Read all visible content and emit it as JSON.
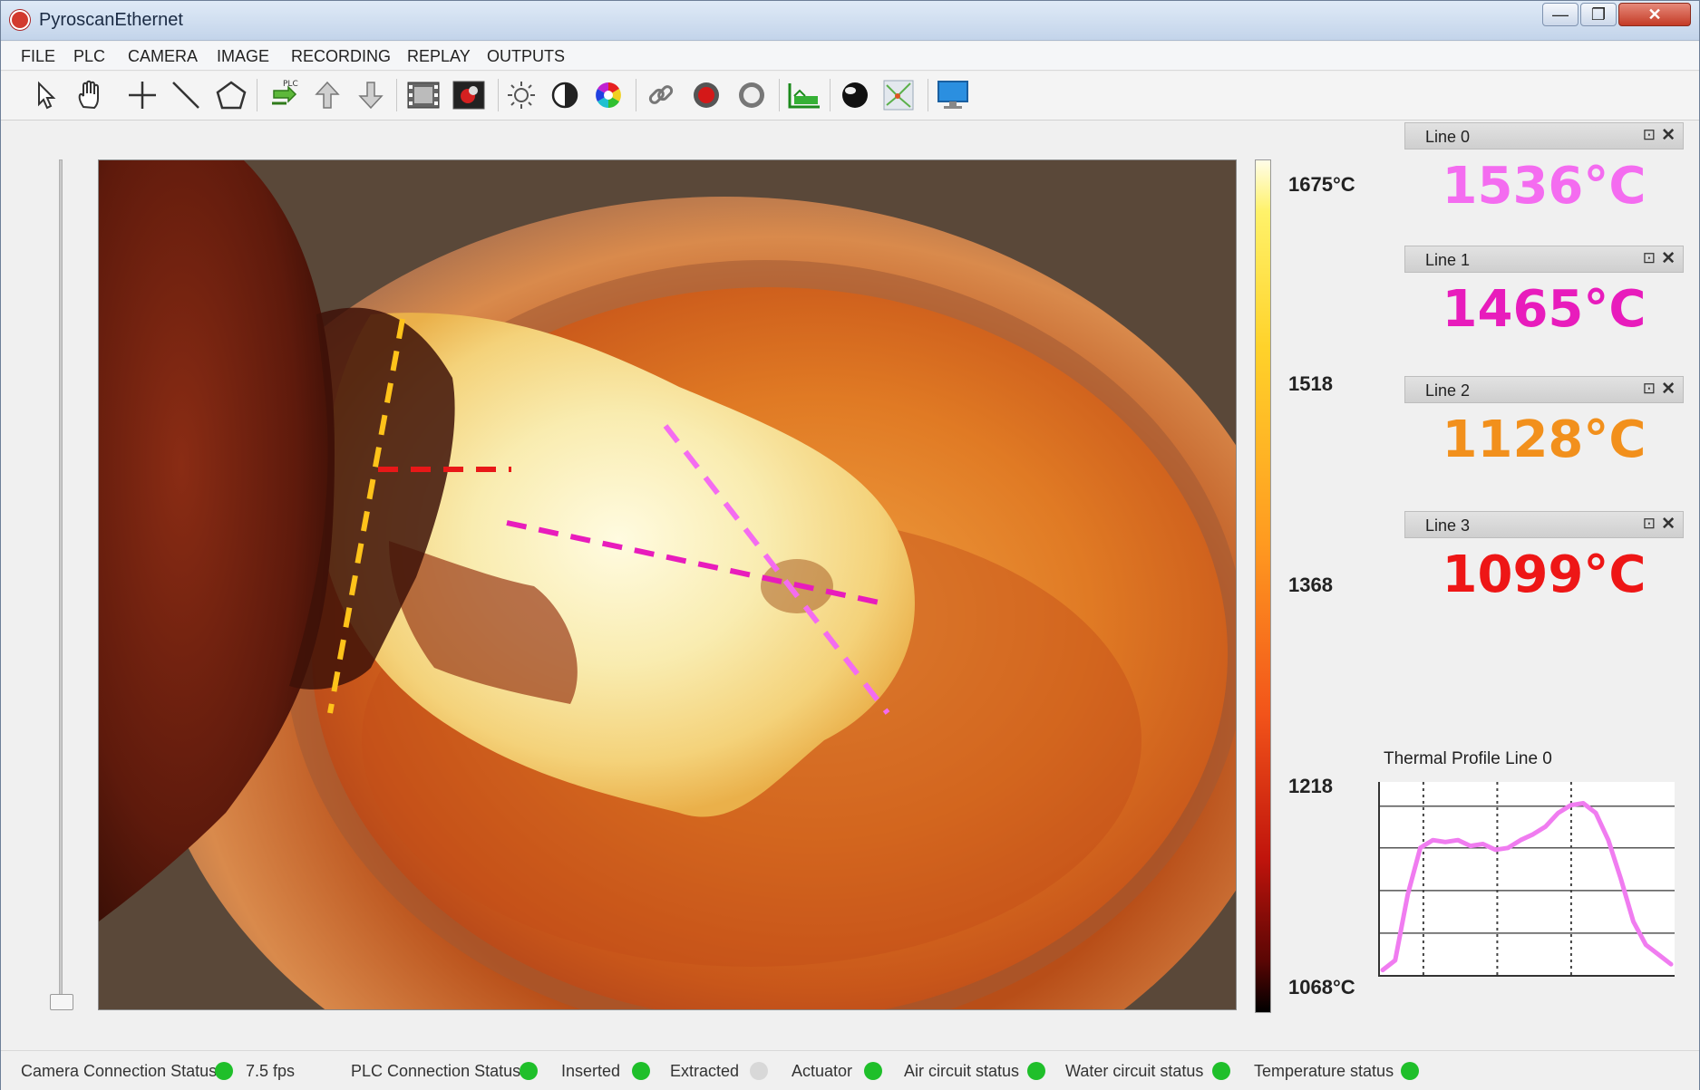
{
  "window": {
    "title": "PyroscanEthernet",
    "min_glyph": "—",
    "max_glyph": "❐",
    "close_glyph": "✕"
  },
  "menu": [
    "FILE",
    "PLC",
    "CAMERA",
    "IMAGE",
    "RECORDING",
    "REPLAY",
    "OUTPUTS"
  ],
  "toolbar": {
    "icons": [
      "pointer-icon",
      "hand-icon",
      "crosshair-icon",
      "line-tool-icon",
      "polygon-icon",
      "plc-icon",
      "arrow-up-icon",
      "arrow-down-icon",
      "film-icon",
      "snapshot-icon",
      "brightness-icon",
      "contrast-icon",
      "color-palette-icon",
      "link-icon",
      "record-icon",
      "stop-icon",
      "graph-icon",
      "sphere-icon",
      "layers-icon",
      "monitor-icon"
    ],
    "plc_badge": "PLC"
  },
  "scale": {
    "top": "1675°C",
    "mid1": "1518",
    "mid2": "1368",
    "mid3": "1218",
    "bottom": "1068°C"
  },
  "lines": [
    {
      "name": "Line 0",
      "temp": "1536°C",
      "color": "#f46cf0"
    },
    {
      "name": "Line 1",
      "temp": "1465°C",
      "color": "#e81cbc"
    },
    {
      "name": "Line 2",
      "temp": "1128°C",
      "color": "#f2901c"
    },
    {
      "name": "Line 3",
      "temp": "1099°C",
      "color": "#ee1616"
    }
  ],
  "panel_icons": {
    "pin": "⊡",
    "close": "✕"
  },
  "profile": {
    "title": "Thermal Profile Line 0",
    "color": "#f07cf0",
    "chart_data": {
      "type": "line",
      "title": "Thermal Profile Line 0",
      "xlabel": "",
      "ylabel": "",
      "grid": true,
      "series": [
        {
          "values": [
            0.03,
            0.08,
            0.42,
            0.66,
            0.7,
            0.69,
            0.7,
            0.67,
            0.68,
            0.65,
            0.66,
            0.7,
            0.73,
            0.77,
            0.84,
            0.88,
            0.89,
            0.84,
            0.7,
            0.5,
            0.28,
            0.16,
            0.11,
            0.06
          ]
        }
      ]
    }
  },
  "status": {
    "camera_label": "Camera Connection Status",
    "fps": "7.5 fps",
    "plc_label": "PLC Connection Status",
    "inserted": "Inserted",
    "extracted": "Extracted",
    "actuator": "Actuator",
    "air": "Air circuit status",
    "water": "Water circuit status",
    "temperature": "Temperature status",
    "on_color": "#1fbf2a",
    "off_color": "#d8d8d8"
  }
}
